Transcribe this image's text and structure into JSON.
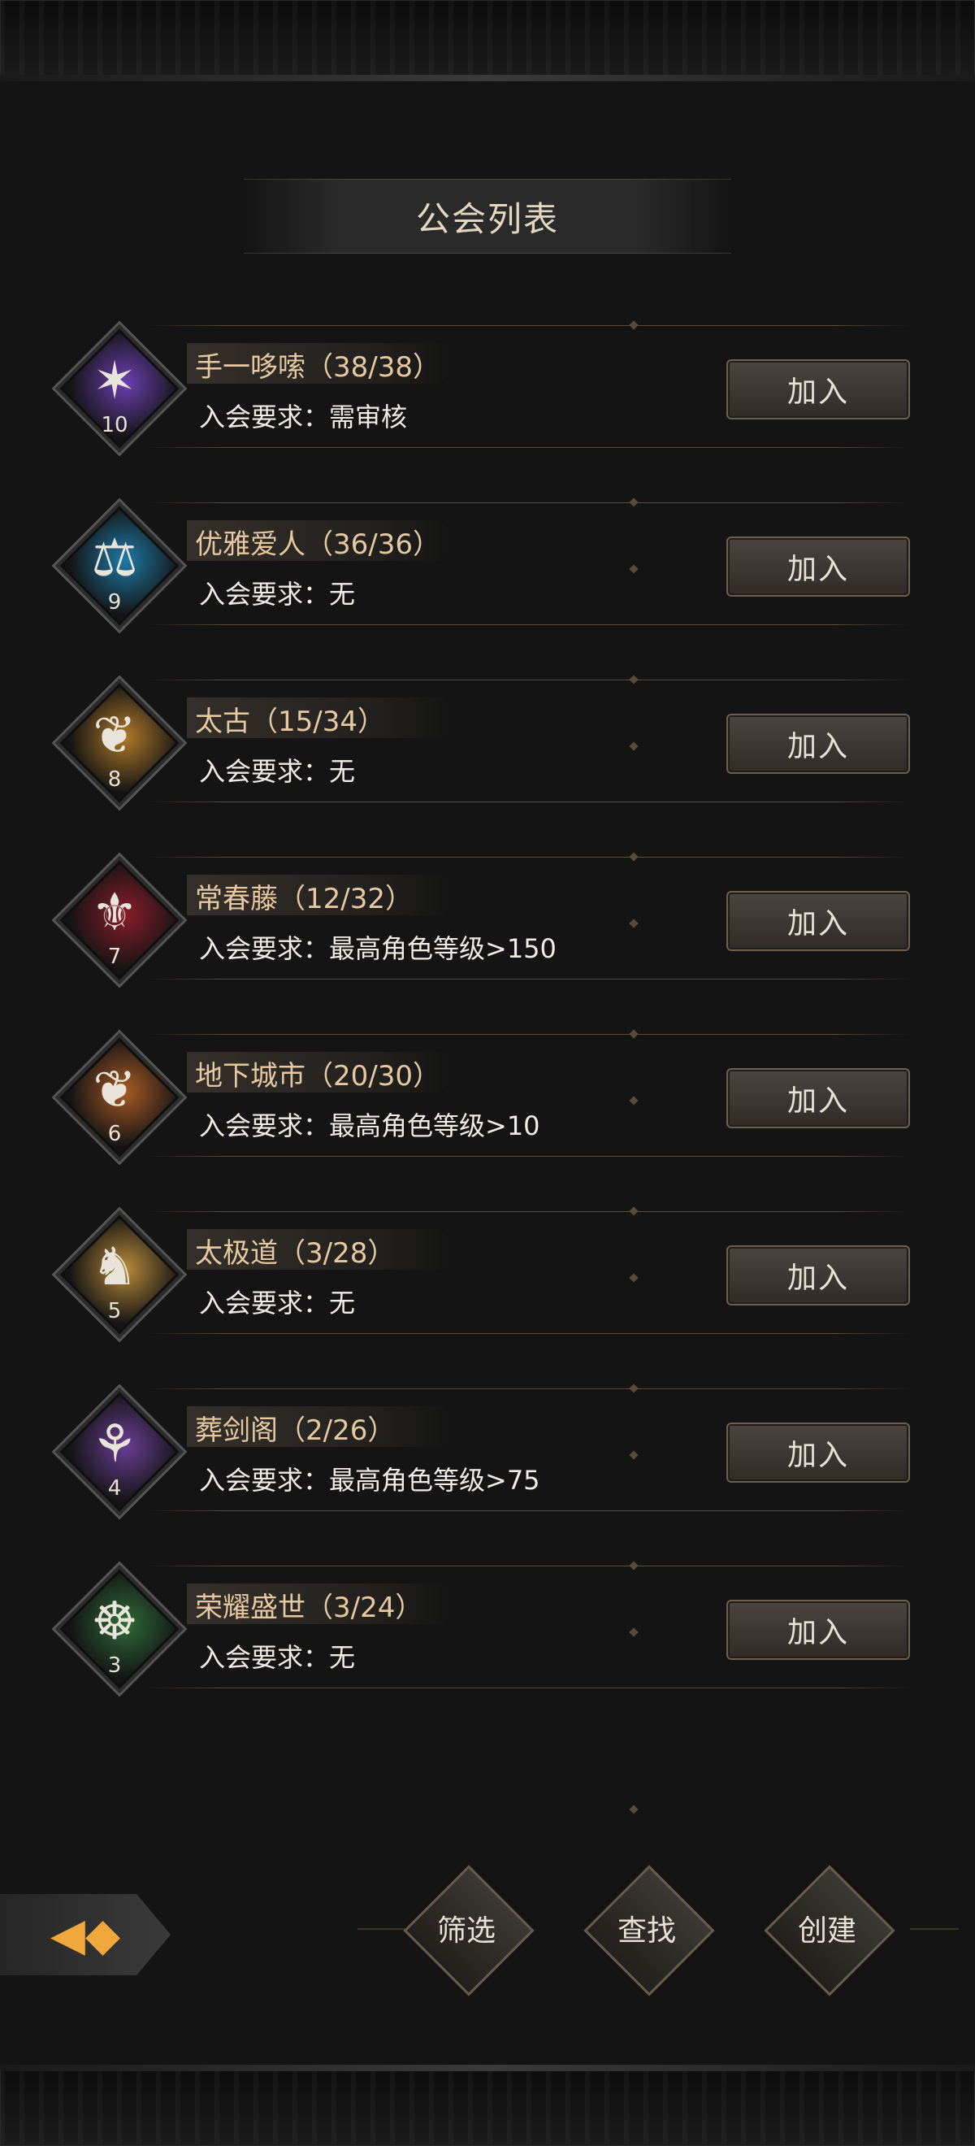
{
  "title": "公会列表",
  "guilds": [
    {
      "name": "手一哆嗦（38/38）",
      "requirement": "入会要求：需审核",
      "level": "10",
      "join_label": "加入",
      "emblem_icon": "sorcerer-emblem-icon",
      "emblem_color": "#6b3fb0"
    },
    {
      "name": "优雅爱人（36/36）",
      "requirement": "入会要求：无",
      "level": "9",
      "join_label": "加入",
      "emblem_icon": "scales-emblem-icon",
      "emblem_color": "#1e7aa6"
    },
    {
      "name": "太古（15/34）",
      "requirement": "入会要求：无",
      "level": "8",
      "join_label": "加入",
      "emblem_icon": "crest-emblem-icon",
      "emblem_color": "#b07a2a"
    },
    {
      "name": "常春藤（12/32）",
      "requirement": "入会要求：最高角色等级>150",
      "level": "7",
      "join_label": "加入",
      "emblem_icon": "dragon-emblem-icon",
      "emblem_color": "#8a1d2a"
    },
    {
      "name": "地下城市（20/30）",
      "requirement": "入会要求：最高角色等级>10",
      "level": "6",
      "join_label": "加入",
      "emblem_icon": "crest-emblem-icon",
      "emblem_color": "#a85a25"
    },
    {
      "name": "太极道（3/28）",
      "requirement": "入会要求：无",
      "level": "5",
      "join_label": "加入",
      "emblem_icon": "unicorn-emblem-icon",
      "emblem_color": "#b88a3a"
    },
    {
      "name": "葬剑阁（2/26）",
      "requirement": "入会要求：最高角色等级>75",
      "level": "4",
      "join_label": "加入",
      "emblem_icon": "stag-emblem-icon",
      "emblem_color": "#6a3e96"
    },
    {
      "name": "荣耀盛世（3/24）",
      "requirement": "入会要求：无",
      "level": "3",
      "join_label": "加入",
      "emblem_icon": "serpent-emblem-icon",
      "emblem_color": "#2f6b3a"
    }
  ],
  "actions": {
    "filter": "筛选",
    "search": "查找",
    "create": "创建"
  }
}
